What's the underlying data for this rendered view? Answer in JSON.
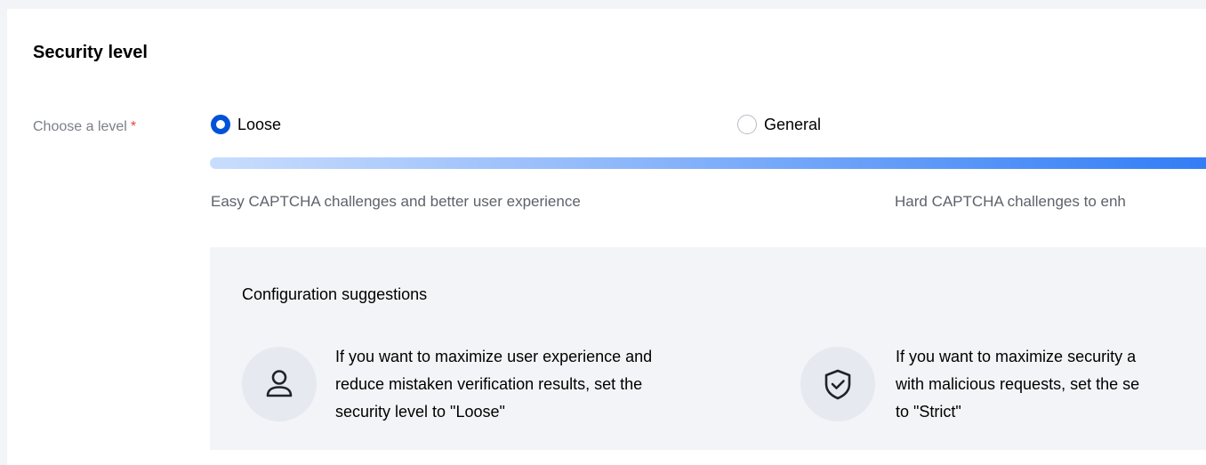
{
  "section": {
    "title": "Security level"
  },
  "level_field": {
    "label": "Choose a level",
    "required_mark": "*",
    "options": [
      {
        "label": "Loose",
        "checked": true
      },
      {
        "label": "General",
        "checked": false
      }
    ],
    "bar_colors": [
      "#c9ddfd",
      "#2f7cf6"
    ],
    "desc_left": "Easy CAPTCHA challenges and better user experience",
    "desc_right": "Hard CAPTCHA challenges to enh"
  },
  "suggestions": {
    "title": "Configuration suggestions",
    "items": [
      {
        "icon": "user-icon",
        "lines": [
          "If you want to maximize user experience and",
          "reduce mistaken verification results, set the",
          "security level to \"Loose\""
        ]
      },
      {
        "icon": "shield-check-icon",
        "lines": [
          "If you want to maximize security a",
          "with malicious requests, set the se",
          "to \"Strict\""
        ]
      }
    ]
  },
  "colors": {
    "primary": "#0052d9",
    "required": "#e54545",
    "label_gray": "#7a7f87",
    "panel_bg": "#f3f4f7"
  }
}
